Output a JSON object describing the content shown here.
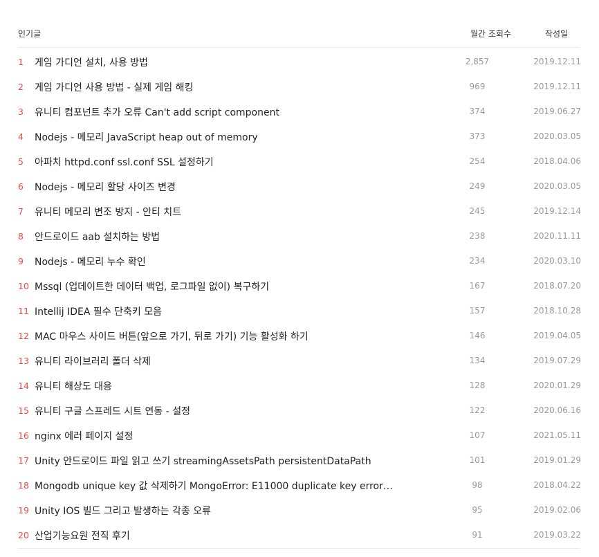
{
  "header": {
    "title": "인기글",
    "views": "월간 조회수",
    "date": "작성일"
  },
  "colors": {
    "rank": "#f04a3a",
    "text": "#222222",
    "muted": "#999999",
    "divider": "#ececec"
  },
  "posts": [
    {
      "rank": "1",
      "title": "게임 가디언 설치, 사용 방법",
      "views": "2,857",
      "date": "2019.12.11"
    },
    {
      "rank": "2",
      "title": "게임 가디언 사용 방법 - 실제 게임 해킹",
      "views": "969",
      "date": "2019.12.11"
    },
    {
      "rank": "3",
      "title": "유니티 컴포넌트 추가 오류 Can't add script component",
      "views": "374",
      "date": "2019.06.27"
    },
    {
      "rank": "4",
      "title": "Nodejs - 메모리 JavaScript heap out of memory",
      "views": "373",
      "date": "2020.03.05"
    },
    {
      "rank": "5",
      "title": "아파치 httpd.conf ssl.conf SSL 설정하기",
      "views": "254",
      "date": "2018.04.06"
    },
    {
      "rank": "6",
      "title": "Nodejs - 메모리 할당 사이즈 변경",
      "views": "249",
      "date": "2020.03.05"
    },
    {
      "rank": "7",
      "title": "유니티 메모리 변조 방지 - 안티 치트",
      "views": "245",
      "date": "2019.12.14"
    },
    {
      "rank": "8",
      "title": "안드로이드 aab 설치하는 방법",
      "views": "238",
      "date": "2020.11.11"
    },
    {
      "rank": "9",
      "title": "Nodejs - 메모리 누수 확인",
      "views": "234",
      "date": "2020.03.10"
    },
    {
      "rank": "10",
      "title": "Mssql (업데이트한 데이터 백업, 로그파일 없이) 복구하기",
      "views": "167",
      "date": "2018.07.20"
    },
    {
      "rank": "11",
      "title": "Intellij IDEA 필수 단축키 모음",
      "views": "157",
      "date": "2018.10.28"
    },
    {
      "rank": "12",
      "title": "MAC 마우스 사이드 버튼(앞으로 가기, 뒤로 가기) 기능 활성화 하기",
      "views": "146",
      "date": "2019.04.05"
    },
    {
      "rank": "13",
      "title": "유니티 라이브러리 폴더 삭제",
      "views": "134",
      "date": "2019.07.29"
    },
    {
      "rank": "14",
      "title": "유니티 해상도 대응",
      "views": "128",
      "date": "2020.01.29"
    },
    {
      "rank": "15",
      "title": "유니티 구글 스프레드 시트 연동 - 설정",
      "views": "122",
      "date": "2020.06.16"
    },
    {
      "rank": "16",
      "title": "nginx 에러 페이지 설정",
      "views": "107",
      "date": "2021.05.11"
    },
    {
      "rank": "17",
      "title": "Unity 안드로이드 파일 읽고 쓰기 streamingAssetsPath persistentDataPath",
      "views": "101",
      "date": "2019.01.29"
    },
    {
      "rank": "18",
      "title": "Mongodb unique key 값 삭제하기 MongoError: E11000 duplicate key error…",
      "views": "98",
      "date": "2018.04.22"
    },
    {
      "rank": "19",
      "title": "Unity IOS 빌드 그리고 발생하는 각종 오류",
      "views": "95",
      "date": "2019.02.06"
    },
    {
      "rank": "20",
      "title": "산업기능요원 전직 후기",
      "views": "91",
      "date": "2019.03.22"
    }
  ]
}
